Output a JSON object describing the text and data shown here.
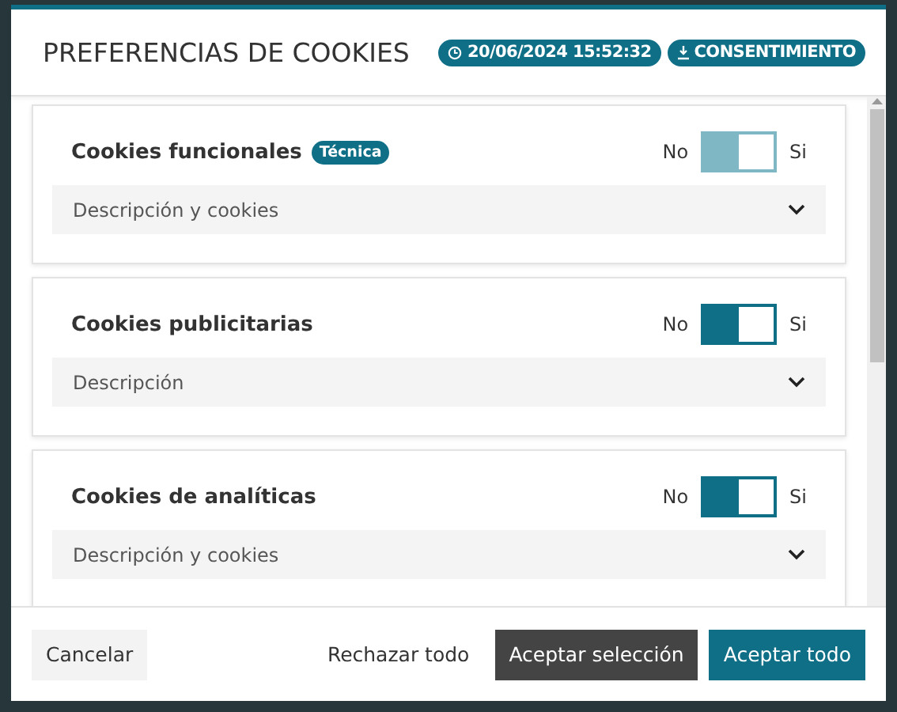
{
  "dialog": {
    "title": "PREFERENCIAS DE COOKIES",
    "timestamp": "20/06/2024 15:52:32",
    "consent_button": "CONSENTIMIENTO"
  },
  "categories": [
    {
      "name": "Cookies funcionales",
      "tag": "Técnica",
      "off_label": "No",
      "on_label": "Si",
      "on": true,
      "disabled": true,
      "details": "Descripción y cookies",
      "expanded": false
    },
    {
      "name": "Cookies publicitarias",
      "off_label": "No",
      "on_label": "Si",
      "on": true,
      "disabled": false,
      "details": "Descripción",
      "expanded": false
    },
    {
      "name": "Cookies de analíticas",
      "off_label": "No",
      "on_label": "Si",
      "on": true,
      "disabled": false,
      "details": "Descripción y cookies",
      "expanded": false
    }
  ],
  "footer": {
    "cancel": "Cancelar",
    "reject_all": "Rechazar todo",
    "accept_selection": "Aceptar selección",
    "accept_all": "Aceptar todo"
  }
}
